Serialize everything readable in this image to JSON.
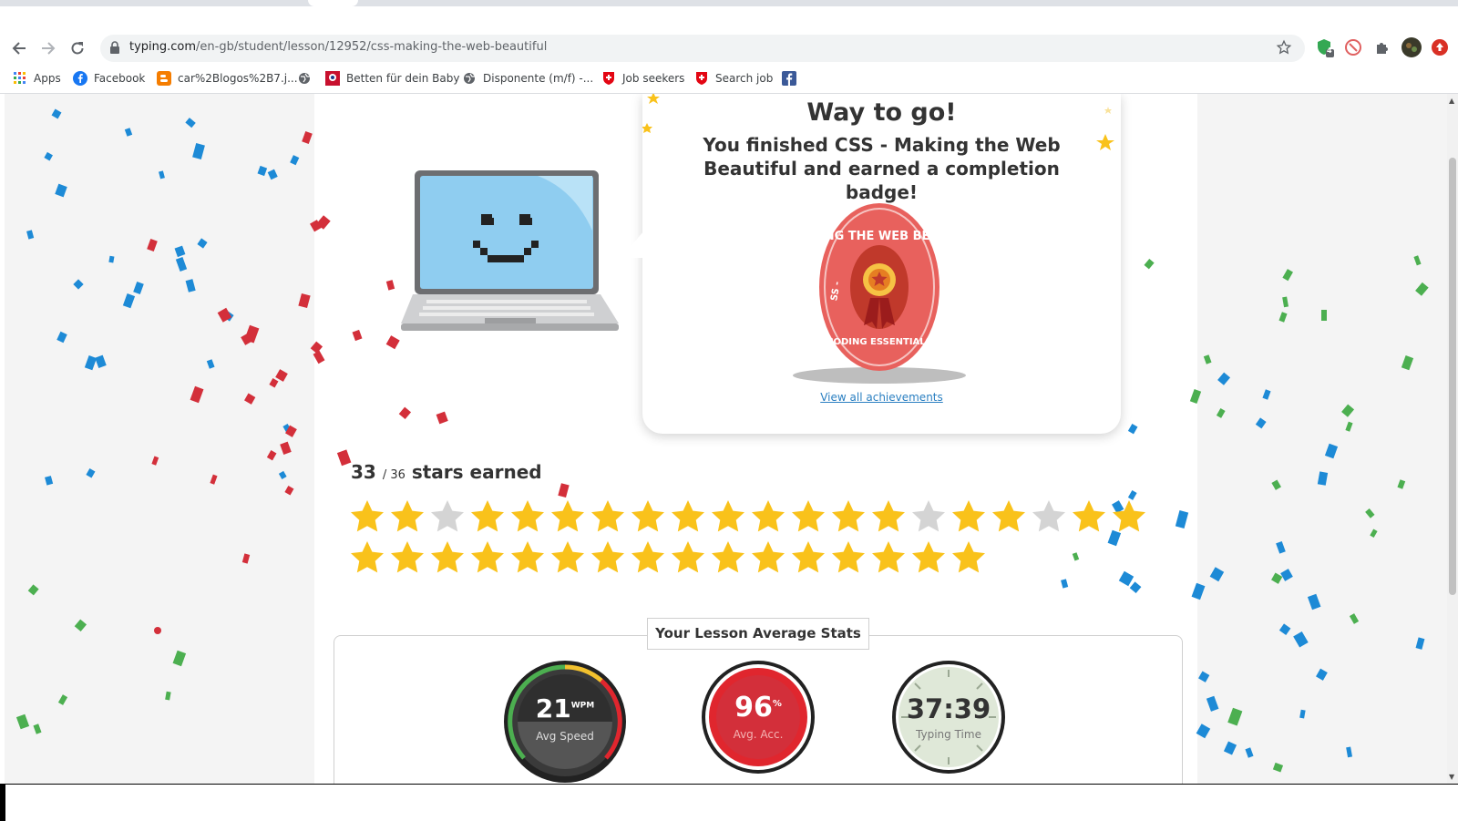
{
  "browser": {
    "url_host": "typing.com",
    "url_path": "/en-gb/student/lesson/12952/css-making-the-web-beautiful",
    "extension_badge": "4"
  },
  "bookmarks": [
    {
      "label": "Apps",
      "icon": "apps-grid-icon"
    },
    {
      "label": "Facebook",
      "icon": "facebook-icon"
    },
    {
      "label": "car%2Blogos%2B7.j...",
      "icon": "blogger-icon"
    },
    {
      "label": "",
      "icon": "globe-icon"
    },
    {
      "label": "Betten für dein Baby",
      "icon": "baby-store-icon"
    },
    {
      "label": "Disponente (m/f) -...",
      "icon": "globe-icon"
    },
    {
      "label": "Job seekers",
      "icon": "swiss-shield-icon"
    },
    {
      "label": "Search job",
      "icon": "swiss-shield-icon"
    },
    {
      "label": "",
      "icon": "facebook-icon"
    }
  ],
  "completion": {
    "heading": "Way to go!",
    "message": "You finished CSS - Making the Web Beautiful and earned a completion badge!",
    "badge_ring_top": "MAKING THE WEB BEAUTIF",
    "badge_ring_bottom": "CODING ESSENTIALS",
    "badge_ring_left": "SS -",
    "achievements_link": "View all achievements"
  },
  "stars": {
    "earned": "33",
    "total": "/ 36",
    "suffix": "stars earned",
    "row1": [
      1,
      1,
      0,
      1,
      1,
      1,
      1,
      1,
      1,
      1,
      1,
      1,
      1,
      1,
      0,
      1,
      1,
      0,
      1,
      1
    ],
    "row2": [
      1,
      1,
      1,
      1,
      1,
      1,
      1,
      1,
      1,
      1,
      1,
      1,
      1,
      1,
      1,
      1
    ]
  },
  "stats": {
    "title": "Your Lesson Average Stats",
    "speed_value": "21",
    "speed_unit": "WPM",
    "speed_label": "Avg Speed",
    "accuracy_value": "96",
    "accuracy_unit": "%",
    "accuracy_label": "Avg. Acc.",
    "time_value": "37:39",
    "time_label": "Typing Time"
  },
  "colors": {
    "star_gold": "#f9c21b",
    "star_grey": "#d4d4d4",
    "badge_red": "#e8615d",
    "accuracy_red": "#e0262e",
    "confetti_blue": "#1d8ad6",
    "confetti_red": "#d32f3a",
    "confetti_green": "#4caf50",
    "laptop_screen": "#8fcdf0"
  }
}
